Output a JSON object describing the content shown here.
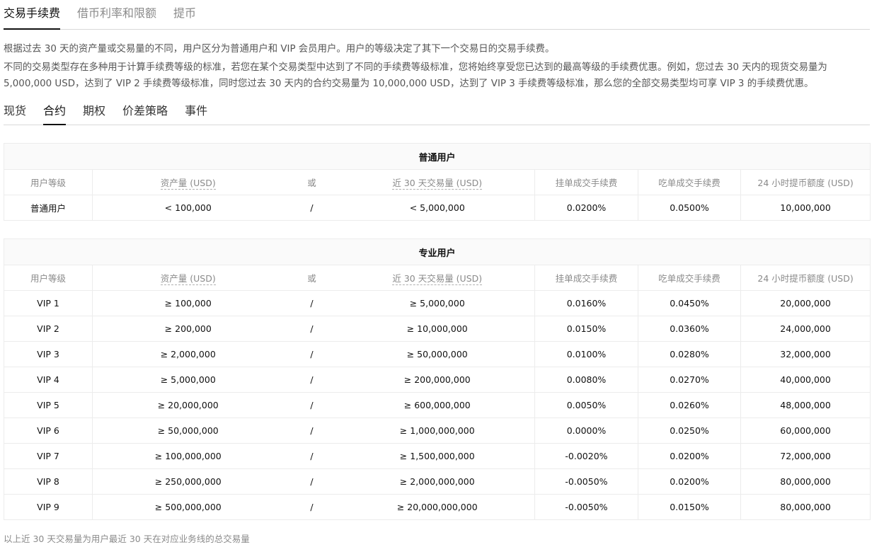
{
  "top_tabs": [
    "交易手续费",
    "借币利率和限额",
    "提币"
  ],
  "description": {
    "p1": "根据过去 30 天的资产量或交易量的不同，用户区分为普通用户和 VIP 会员用户。用户的等级决定了其下一个交易日的交易手续费。",
    "p2": "不同的交易类型存在多种用于计算手续费等级的标准，若您在某个交易类型中达到了不同的手续费等级标准，您将始终享受您已达到的最高等级的手续费优惠。例如，您过去 30 天内的现货交易量为 5,000,000 USD，达到了 VIP 2 手续费等级标准，同时您过去 30 天内的合约交易量为 10,000,000 USD，达到了 VIP 3 手续费等级标准，那么您的全部交易类型均可享 VIP 3 的手续费优惠。"
  },
  "sub_tabs": [
    "现货",
    "合约",
    "期权",
    "价差策略",
    "事件"
  ],
  "columns": {
    "level": "用户等级",
    "assets": "资产量 (USD)",
    "or": "或",
    "volume": "近 30 天交易量 (USD)",
    "maker": "挂单成交手续费",
    "taker": "吃单成交手续费",
    "withdraw": "24 小时提币额度 (USD)"
  },
  "regular": {
    "title": "普通用户",
    "rows": [
      {
        "level": "普通用户",
        "assets": "< 100,000",
        "or": "/",
        "volume": "< 5,000,000",
        "maker": "0.0200%",
        "taker": "0.0500%",
        "withdraw": "10,000,000"
      }
    ]
  },
  "pro": {
    "title": "专业用户",
    "rows": [
      {
        "level": "VIP 1",
        "assets": "≥ 100,000",
        "or": "/",
        "volume": "≥ 5,000,000",
        "maker": "0.0160%",
        "taker": "0.0450%",
        "withdraw": "20,000,000"
      },
      {
        "level": "VIP 2",
        "assets": "≥ 200,000",
        "or": "/",
        "volume": "≥ 10,000,000",
        "maker": "0.0150%",
        "taker": "0.0360%",
        "withdraw": "24,000,000"
      },
      {
        "level": "VIP 3",
        "assets": "≥ 2,000,000",
        "or": "/",
        "volume": "≥ 50,000,000",
        "maker": "0.0100%",
        "taker": "0.0280%",
        "withdraw": "32,000,000"
      },
      {
        "level": "VIP 4",
        "assets": "≥ 5,000,000",
        "or": "/",
        "volume": "≥ 200,000,000",
        "maker": "0.0080%",
        "taker": "0.0270%",
        "withdraw": "40,000,000"
      },
      {
        "level": "VIP 5",
        "assets": "≥ 20,000,000",
        "or": "/",
        "volume": "≥ 600,000,000",
        "maker": "0.0050%",
        "taker": "0.0260%",
        "withdraw": "48,000,000"
      },
      {
        "level": "VIP 6",
        "assets": "≥ 50,000,000",
        "or": "/",
        "volume": "≥ 1,000,000,000",
        "maker": "0.0000%",
        "taker": "0.0250%",
        "withdraw": "60,000,000"
      },
      {
        "level": "VIP 7",
        "assets": "≥ 100,000,000",
        "or": "/",
        "volume": "≥ 1,500,000,000",
        "maker": "-0.0020%",
        "taker": "0.0200%",
        "withdraw": "72,000,000"
      },
      {
        "level": "VIP 8",
        "assets": "≥ 250,000,000",
        "or": "/",
        "volume": "≥ 2,000,000,000",
        "maker": "-0.0050%",
        "taker": "0.0200%",
        "withdraw": "80,000,000"
      },
      {
        "level": "VIP 9",
        "assets": "≥ 500,000,000",
        "or": "/",
        "volume": "≥ 20,000,000,000",
        "maker": "-0.0050%",
        "taker": "0.0150%",
        "withdraw": "80,000,000"
      }
    ]
  },
  "footnote": "以上近 30 天交易量为用户最近 30 天在对应业务线的总交易量"
}
